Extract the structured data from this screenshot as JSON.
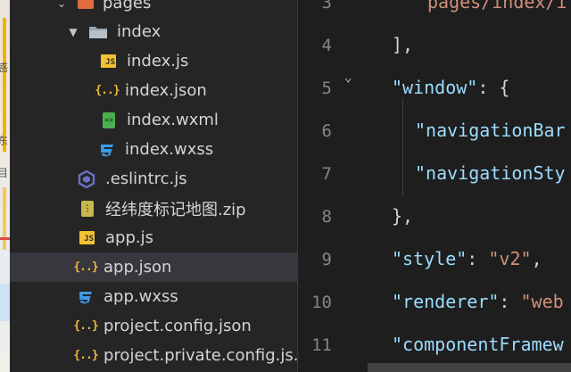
{
  "explorer": {
    "items": [
      {
        "label": "pages",
        "icon": "pages-folder-icon",
        "kind": "folder-open"
      },
      {
        "label": "index",
        "icon": "folder-icon",
        "kind": "folder-open"
      },
      {
        "label": "index.js",
        "icon": "js-file-icon",
        "kind": "file"
      },
      {
        "label": "index.json",
        "icon": "json-file-icon",
        "kind": "file"
      },
      {
        "label": "index.wxml",
        "icon": "wxml-file-icon",
        "kind": "file"
      },
      {
        "label": "index.wxss",
        "icon": "wxss-file-icon",
        "kind": "file"
      },
      {
        "label": ".eslintrc.js",
        "icon": "eslint-file-icon",
        "kind": "file"
      },
      {
        "label": "经纬度标记地图.zip",
        "icon": "zip-file-icon",
        "kind": "file"
      },
      {
        "label": "app.js",
        "icon": "js-file-icon",
        "kind": "file"
      },
      {
        "label": "app.json",
        "icon": "json-file-icon",
        "kind": "file",
        "selected": true
      },
      {
        "label": "app.wxss",
        "icon": "wxss-file-icon",
        "kind": "file"
      },
      {
        "label": "project.config.json",
        "icon": "json-file-icon",
        "kind": "file"
      },
      {
        "label": "project.private.config.js...",
        "icon": "json-file-icon",
        "kind": "file"
      }
    ]
  },
  "editor": {
    "line_numbers": [
      "3",
      "4",
      "5",
      "6",
      "7",
      "8",
      "9",
      "10",
      "11"
    ],
    "lines": [
      {
        "t1": "",
        "t2": "pages/index/i"
      },
      {
        "t1": "],"
      },
      {
        "key": "\"window\"",
        "rest": ": {"
      },
      {
        "key": "\"navigationBar"
      },
      {
        "key": "\"navigationSty"
      },
      {
        "t1": "},"
      },
      {
        "key": "\"style\"",
        "rest": ": ",
        "val": "\"v2\"",
        "tail": ","
      },
      {
        "key": "\"renderer\"",
        "rest": ": ",
        "val": "\"web"
      },
      {
        "key": "\"componentFramew"
      }
    ]
  },
  "map_strip": {
    "chars": [
      "惑",
      "东",
      "目"
    ]
  },
  "colors": {
    "explorer_bg": "#252526",
    "editor_bg": "#1e1e1e",
    "selected_row": "#37373d",
    "json_key": "#9cdcfe",
    "json_string": "#ce9178"
  }
}
